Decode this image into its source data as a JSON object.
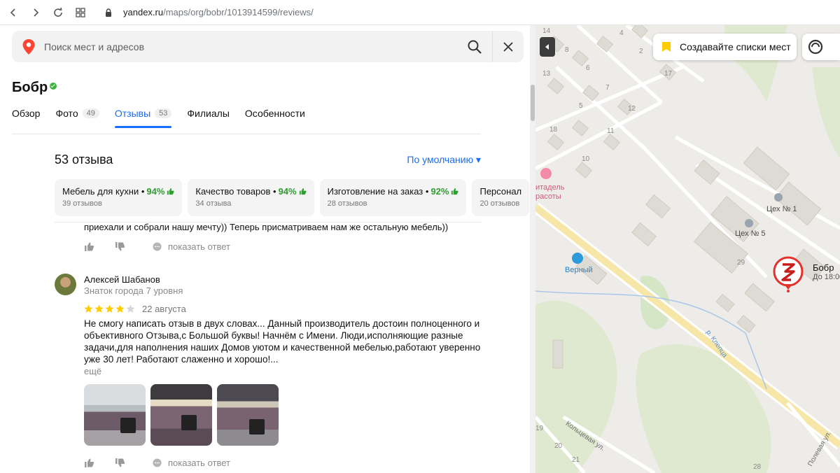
{
  "browser": {
    "url_host": "yandex.ru",
    "url_path": "/maps/org/bobr/1013914599/reviews/"
  },
  "search": {
    "placeholder": "Поиск мест и адресов"
  },
  "org": {
    "name": "Бобр"
  },
  "tabs": [
    {
      "label": "Обзор",
      "count": ""
    },
    {
      "label": "Фото",
      "count": "49"
    },
    {
      "label": "Отзывы",
      "count": "53",
      "active": true
    },
    {
      "label": "Филиалы",
      "count": ""
    },
    {
      "label": "Особенности",
      "count": ""
    }
  ],
  "reviews": {
    "heading": "53 отзыва",
    "sort_label": "По умолчанию ▾",
    "aspects": [
      {
        "label": "Мебель для кухни •",
        "percent": "94%",
        "count": "39 отзывов"
      },
      {
        "label": "Качество товаров •",
        "percent": "94%",
        "count": "34 отзыва"
      },
      {
        "label": "Изготовление на заказ •",
        "percent": "92%",
        "count": "28 отзывов"
      },
      {
        "label": "Персонал",
        "percent": "",
        "count": "20 отзывов"
      }
    ],
    "previous_text": "приехали и собрали нашу мечту)) Теперь присматриваем нам же остальную мебель))",
    "reply_label": "показать ответ",
    "item": {
      "author": "Алексей Шабанов",
      "level": "Знаток города 7 уровня",
      "rating": 4,
      "rating_max": 5,
      "date": "22 августа",
      "text": "Не смогу написать отзыв в двух словах... Данный производитель достоин полноценного и объективного Отзыва,с Большой буквы! Начнём с Имени. Люди,исполняющие разные задачи,для наполнения наших Домов уютом и качественной мебелью,работают уверенно уже 30 лет! Работают слаженно и хорошо!...",
      "more": "ещё"
    }
  },
  "map": {
    "lists_button": "Создавайте списки мест",
    "business_name": "Бобр",
    "business_hours": "До 18:00",
    "labels": {
      "ceh1": "Цех № 1",
      "ceh5": "Цех № 5",
      "verny": "Верный",
      "citadel_1": "итадель",
      "citadel_2": "расоты",
      "river": "р. Клепца",
      "street1": "Кольцевая ул.",
      "street2": "Полевая ул."
    },
    "house_numbers": [
      "14",
      "4",
      "2",
      "8",
      "6",
      "13",
      "17",
      "7",
      "5",
      "12",
      "18",
      "11",
      "10",
      "29",
      "19",
      "20",
      "21",
      "28"
    ]
  },
  "colors": {
    "accent": "#196dff",
    "positive": "#2e9e2e",
    "star": "#fc0",
    "pin_red": "#e5322d"
  }
}
